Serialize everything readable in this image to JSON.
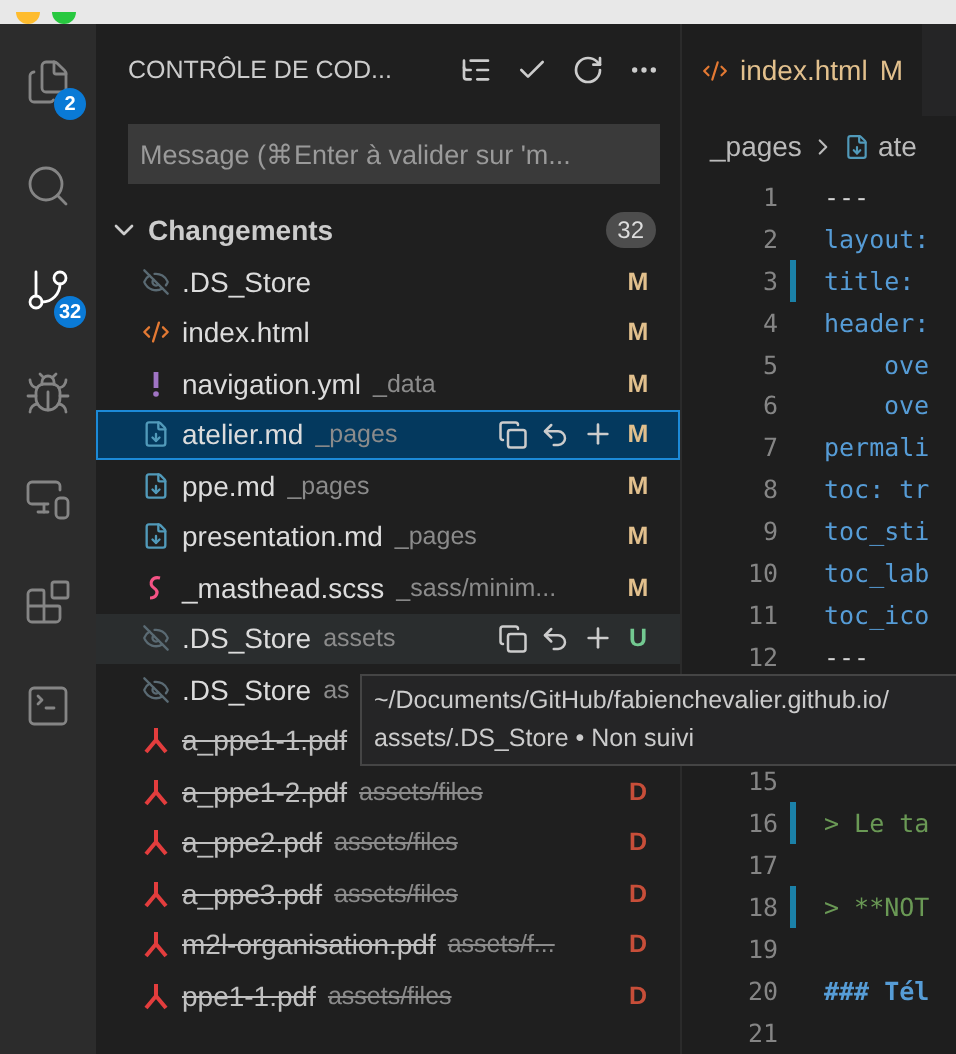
{
  "activity_bar": [
    {
      "kind": "files",
      "badge": "2",
      "selected": false
    },
    {
      "kind": "search",
      "selected": false
    },
    {
      "kind": "scm",
      "badge": "32",
      "selected": true
    },
    {
      "kind": "debug",
      "selected": false
    },
    {
      "kind": "remote",
      "selected": false
    },
    {
      "kind": "extensions",
      "selected": false
    },
    {
      "kind": "terminal",
      "selected": false
    }
  ],
  "sidebar": {
    "title": "CONTRÔLE DE COD...",
    "message": {
      "placeholder": "Message (⌘Enter à valider sur 'm..."
    },
    "group": {
      "label": "Changements",
      "count": "32",
      "expanded": true
    },
    "files": [
      {
        "kind": "ignored",
        "name": ".DS_Store",
        "status": "M",
        "deleted": false,
        "selected": false,
        "hovered": false
      },
      {
        "kind": "html",
        "name": "index.html",
        "status": "M",
        "deleted": false,
        "selected": false,
        "hovered": false
      },
      {
        "kind": "yaml",
        "name": "navigation.yml",
        "path": "_data",
        "status": "M",
        "deleted": false,
        "selected": false,
        "hovered": false
      },
      {
        "kind": "markdown",
        "name": "atelier.md",
        "path": "_pages",
        "status": "M",
        "deleted": false,
        "selected": true,
        "hovered": false
      },
      {
        "kind": "markdown",
        "name": "ppe.md",
        "path": "_pages",
        "status": "M",
        "deleted": false,
        "selected": false,
        "hovered": false
      },
      {
        "kind": "markdown",
        "name": "presentation.md",
        "path": "_pages",
        "status": "M",
        "deleted": false,
        "selected": false,
        "hovered": false
      },
      {
        "kind": "scss",
        "name": "_masthead.scss",
        "path": "_sass/minim...",
        "status": "M",
        "deleted": false,
        "selected": false,
        "hovered": false
      },
      {
        "kind": "ignored",
        "name": ".DS_Store",
        "path": "assets",
        "status": "U",
        "deleted": false,
        "selected": false,
        "hovered": true
      },
      {
        "kind": "ignored",
        "name": ".DS_Store",
        "path": "as",
        "deleted": false,
        "selected": false,
        "hovered": false
      },
      {
        "kind": "pdf",
        "name": "a_ppe1-1.pdf",
        "deleted": true,
        "selected": false,
        "hovered": false
      },
      {
        "kind": "pdf",
        "name": "a_ppe1-2.pdf",
        "path": "assets/files",
        "status": "D",
        "deleted": true,
        "selected": false,
        "hovered": false
      },
      {
        "kind": "pdf",
        "name": "a_ppe2.pdf",
        "path": "assets/files",
        "status": "D",
        "deleted": true,
        "selected": false,
        "hovered": false
      },
      {
        "kind": "pdf",
        "name": "a_ppe3.pdf",
        "path": "assets/files",
        "status": "D",
        "deleted": true,
        "selected": false,
        "hovered": false
      },
      {
        "kind": "pdf",
        "name": "m2l-organisation.pdf",
        "path": "assets/f...",
        "status": "D",
        "deleted": true,
        "selected": false,
        "hovered": false
      },
      {
        "kind": "pdf",
        "name": "ppe1-1.pdf",
        "path": "assets/files",
        "status": "D",
        "deleted": true,
        "selected": false,
        "hovered": false
      }
    ]
  },
  "tooltip": {
    "lines": [
      "~/Documents/GitHub/fabienchevalier.github.io/",
      "assets/.DS_Store • Non suivi"
    ]
  },
  "editor": {
    "tab": {
      "name": "index.html",
      "status": "M"
    },
    "breadcrumb": [
      "_pages",
      "ate"
    ],
    "lines": [
      {
        "number": "1",
        "kind": "rule",
        "text": "---",
        "modified": false
      },
      {
        "number": "2",
        "kind": "key",
        "text": "layout:",
        "modified": false
      },
      {
        "number": "3",
        "kind": "key",
        "text": "title:",
        "modified": true
      },
      {
        "number": "4",
        "kind": "key",
        "text": "header:",
        "modified": false
      },
      {
        "number": "5",
        "kind": "nested",
        "text": "ove",
        "modified": false
      },
      {
        "number": "6",
        "kind": "nested",
        "text": "ove",
        "modified": false
      },
      {
        "number": "7",
        "kind": "key",
        "text": "permali",
        "modified": false
      },
      {
        "number": "8",
        "kind": "key",
        "text": "toc: tr",
        "modified": false
      },
      {
        "number": "9",
        "kind": "key",
        "text": "toc_sti",
        "modified": false
      },
      {
        "number": "10",
        "kind": "key",
        "text": "toc_lab",
        "modified": false
      },
      {
        "number": "11",
        "kind": "key",
        "text": "toc_ico",
        "modified": false
      },
      {
        "number": "12",
        "kind": "rule",
        "text": "---",
        "modified": false
      },
      {
        "number": "15",
        "modified": false
      },
      {
        "number": "16",
        "kind": "quote",
        "text": "> Le ta",
        "modified": true
      },
      {
        "number": "17",
        "modified": false
      },
      {
        "number": "18",
        "kind": "quote",
        "text": "> **NOT",
        "modified": true
      },
      {
        "number": "19",
        "modified": false
      },
      {
        "number": "20",
        "kind": "heading",
        "text": "### Tél",
        "modified": false
      },
      {
        "number": "21",
        "modified": false
      }
    ]
  }
}
